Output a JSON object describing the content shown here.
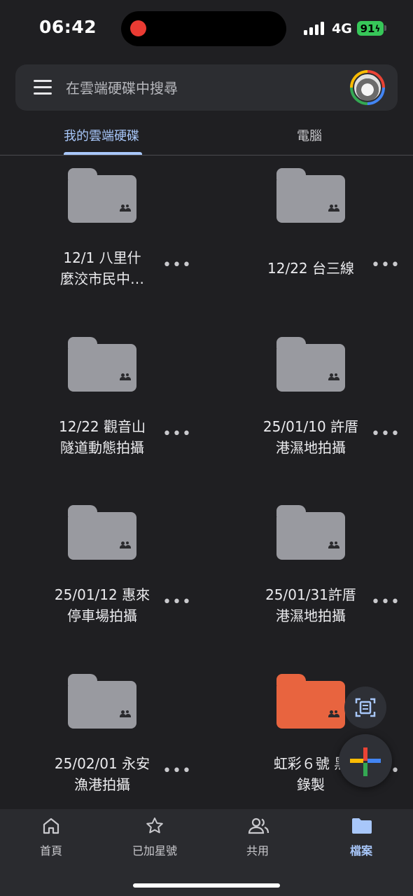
{
  "status_bar": {
    "time": "06:42",
    "network": "4G",
    "battery": "91"
  },
  "search": {
    "placeholder": "在雲端硬碟中搜尋"
  },
  "tabs": [
    {
      "label": "我的雲端硬碟"
    },
    {
      "label": "電腦"
    }
  ],
  "folders": [
    {
      "line1": "12/1 八里什",
      "line2": "麼洨市民中…",
      "color": "#999aa0",
      "shared": true
    },
    {
      "line1": "12/22 台三線",
      "line2": "",
      "color": "#999aa0",
      "shared": true
    },
    {
      "line1": "12/22 觀音山",
      "line2": "隧道動態拍攝",
      "color": "#999aa0",
      "shared": true
    },
    {
      "line1": "25/01/10 許厝",
      "line2": "港濕地拍攝",
      "color": "#999aa0",
      "shared": true
    },
    {
      "line1": "25/01/12 惠來",
      "line2": "停車場拍攝",
      "color": "#999aa0",
      "shared": true
    },
    {
      "line1": "25/01/31許厝",
      "line2": "港濕地拍攝",
      "color": "#999aa0",
      "shared": true
    },
    {
      "line1": "25/02/01 永安",
      "line2": "漁港拍攝",
      "color": "#999aa0",
      "shared": true
    },
    {
      "line1": "虹彩６號 黑",
      "line2": "錄製",
      "color": "#e8643f",
      "shared": true
    }
  ],
  "more_label": "•••",
  "bottom_nav": [
    {
      "label": "首頁",
      "icon": "home-icon"
    },
    {
      "label": "已加星號",
      "icon": "star-icon"
    },
    {
      "label": "共用",
      "icon": "people-icon"
    },
    {
      "label": "檔案",
      "icon": "folder-icon",
      "active": true
    }
  ],
  "colors": {
    "accent": "#a8c7fa",
    "background": "#1f1f22",
    "folder_gray": "#999aa0",
    "folder_orange": "#e8643f"
  }
}
